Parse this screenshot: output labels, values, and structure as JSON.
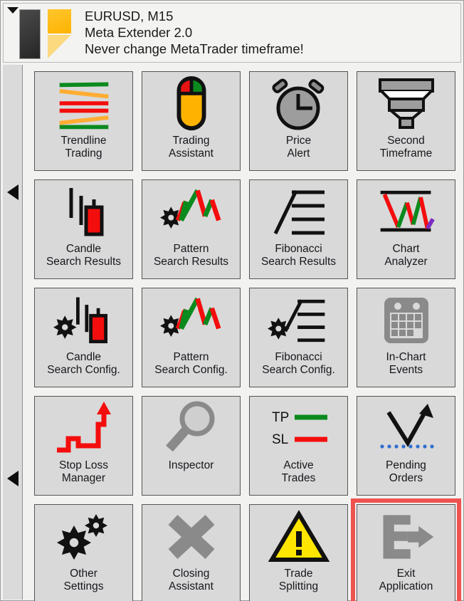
{
  "window": {
    "collapse_icon": "triangle-down-icon",
    "logo_icon": "meta-extender-logo"
  },
  "header": {
    "symbol_timeframe": "EURUSD, M15",
    "product": "Meta Extender 2.0",
    "warning": "Never change MetaTrader timeframe!"
  },
  "sidebar": {
    "arrows": [
      {
        "name": "scroll-left-arrow-top",
        "icon": "triangle-left-icon"
      },
      {
        "name": "scroll-left-arrow-bottom",
        "icon": "triangle-left-icon"
      }
    ]
  },
  "colors": {
    "panel_bg": "#f2f2f1",
    "button_bg": "#d9d9d9",
    "button_border": "#555555",
    "highlight": "#ef5350",
    "accent_yellow": "#ffb300",
    "bull_green": "#0b8a1e",
    "bear_red": "#f40d0d",
    "orange_line": "#ffad33",
    "disabled_gray": "#8a8a8a",
    "purple": "#7b2fbe",
    "blue_dots": "#2f6fd0"
  },
  "buttons": [
    {
      "id": "trendline-trading",
      "label": "Trendline\nTrading",
      "icon": "trendlines-icon",
      "enabled": true,
      "highlighted": false
    },
    {
      "id": "trading-assistant",
      "label": "Trading\nAssistant",
      "icon": "mouse-icon",
      "enabled": true,
      "highlighted": false
    },
    {
      "id": "price-alert",
      "label": "Price\nAlert",
      "icon": "alarm-clock-icon",
      "enabled": true,
      "highlighted": false
    },
    {
      "id": "second-timeframe",
      "label": "Second\nTimeframe",
      "icon": "funnel-stack-icon",
      "enabled": true,
      "highlighted": false
    },
    {
      "id": "candle-search-results",
      "label": "Candle\nSearch Results",
      "icon": "candlestick-icon",
      "enabled": true,
      "highlighted": false
    },
    {
      "id": "pattern-search-results",
      "label": "Pattern\nSearch Results",
      "icon": "zigzag-gear-icon",
      "enabled": true,
      "highlighted": false
    },
    {
      "id": "fibonacci-search-results",
      "label": "Fibonacci\nSearch Results",
      "icon": "fibonacci-icon",
      "enabled": true,
      "highlighted": false
    },
    {
      "id": "chart-analyzer",
      "label": "Chart\nAnalyzer",
      "icon": "chart-analyzer-icon",
      "enabled": true,
      "highlighted": false
    },
    {
      "id": "candle-search-config",
      "label": "Candle\nSearch Config.",
      "icon": "candlestick-gear-icon",
      "enabled": true,
      "highlighted": false
    },
    {
      "id": "pattern-search-config",
      "label": "Pattern\nSearch Config.",
      "icon": "zigzag-gear-icon",
      "enabled": true,
      "highlighted": false
    },
    {
      "id": "fibonacci-search-config",
      "label": "Fibonacci\nSearch Config.",
      "icon": "fibonacci-gear-icon",
      "enabled": true,
      "highlighted": false
    },
    {
      "id": "in-chart-events",
      "label": "In-Chart\nEvents",
      "icon": "calendar-icon",
      "enabled": false,
      "highlighted": false
    },
    {
      "id": "stop-loss-manager",
      "label": "Stop Loss\nManager",
      "icon": "staircase-arrow-icon",
      "enabled": true,
      "highlighted": false
    },
    {
      "id": "inspector",
      "label": "Inspector",
      "icon": "magnifier-icon",
      "enabled": true,
      "highlighted": false
    },
    {
      "id": "active-trades",
      "label": "Active\nTrades",
      "icon": "tp-sl-lines-icon",
      "enabled": true,
      "highlighted": false
    },
    {
      "id": "pending-orders",
      "label": "Pending\nOrders",
      "icon": "pending-arrow-icon",
      "enabled": true,
      "highlighted": false
    },
    {
      "id": "other-settings",
      "label": "Other\nSettings",
      "icon": "gears-icon",
      "enabled": true,
      "highlighted": false
    },
    {
      "id": "closing-assistant",
      "label": "Closing\nAssistant",
      "icon": "x-cross-icon",
      "enabled": true,
      "highlighted": false
    },
    {
      "id": "trade-splitting",
      "label": "Trade\nSplitting",
      "icon": "warning-triangle-icon",
      "enabled": true,
      "highlighted": false
    },
    {
      "id": "exit-application",
      "label": "Exit\nApplication",
      "icon": "exit-icon",
      "enabled": true,
      "highlighted": true
    }
  ],
  "icon_text": {
    "take_profit": "TP",
    "stop_loss": "SL"
  }
}
